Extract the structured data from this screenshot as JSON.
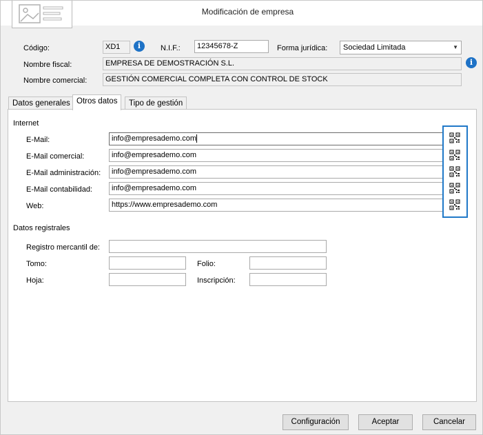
{
  "window": {
    "title": "Modificación de empresa",
    "close_symbol": "✕"
  },
  "header": {
    "codigo_label": "Código:",
    "codigo_value": "XD1",
    "nif_label": "N.I.F.:",
    "nif_value": "12345678-Z",
    "forma_label": "Forma jurídica:",
    "forma_value": "Sociedad Limitada",
    "nombre_fiscal_label": "Nombre fiscal:",
    "nombre_fiscal_value": "EMPRESA DE DEMOSTRACIÓN S.L.",
    "nombre_comercial_label": "Nombre comercial:",
    "nombre_comercial_value": "GESTIÓN COMERCIAL COMPLETA CON CONTROL DE STOCK",
    "info_glyph": "i"
  },
  "tabs": [
    {
      "label": "Datos generales",
      "active": false
    },
    {
      "label": "Otros datos",
      "active": true
    },
    {
      "label": "Tipo de gestión",
      "active": false
    }
  ],
  "internet": {
    "title": "Internet",
    "rows": [
      {
        "label": "E-Mail:",
        "value": "info@empresademo.com"
      },
      {
        "label": "E-Mail comercial:",
        "value": "info@empresademo.com"
      },
      {
        "label": "E-Mail administración:",
        "value": "info@empresademo.com"
      },
      {
        "label": "E-Mail contabilidad:",
        "value": "info@empresademo.com"
      },
      {
        "label": "Web:",
        "value": "https://www.empresademo.com"
      }
    ]
  },
  "registro": {
    "title": "Datos registrales",
    "registro_label": "Registro mercantil de:",
    "tomo_label": "Tomo:",
    "folio_label": "Folio:",
    "hoja_label": "Hoja:",
    "inscripcion_label": "Inscripción:"
  },
  "footer": {
    "config_label": "Configuración",
    "accept_label": "Aceptar",
    "cancel_label": "Cancelar"
  },
  "colors": {
    "accent": "#1f78c8",
    "info": "#1e72c6"
  }
}
